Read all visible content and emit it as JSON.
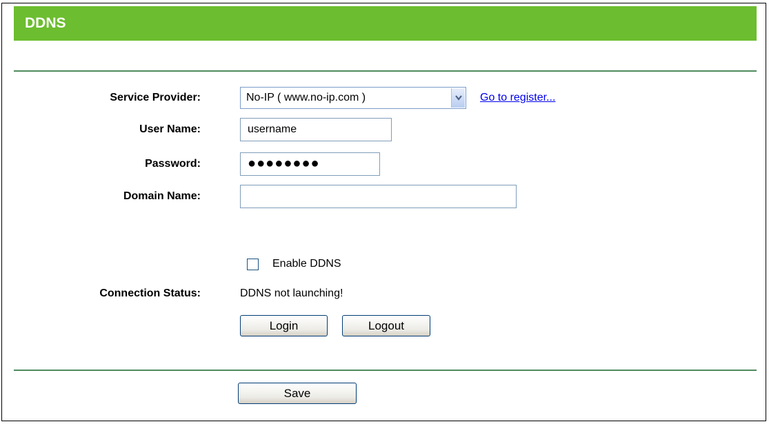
{
  "page": {
    "title": "DDNS"
  },
  "form": {
    "service_provider": {
      "label": "Service Provider:",
      "selected": "No-IP ( www.no-ip.com )",
      "register_link": "Go to register..."
    },
    "user_name": {
      "label": "User Name:",
      "value": "username"
    },
    "password": {
      "label": "Password:",
      "value": "●●●●●●●●"
    },
    "domain_name": {
      "label": "Domain Name:",
      "value": ""
    },
    "enable_ddns": {
      "label": "Enable DDNS",
      "checked": false
    },
    "connection_status": {
      "label": "Connection Status:",
      "value": "DDNS not launching!"
    }
  },
  "buttons": {
    "login": "Login",
    "logout": "Logout",
    "save": "Save"
  },
  "colors": {
    "header_bg": "#6cbd2f",
    "rule": "#4e8a5d",
    "link": "#0000ee"
  },
  "icons": {
    "dropdown": "chevron-down-icon"
  }
}
